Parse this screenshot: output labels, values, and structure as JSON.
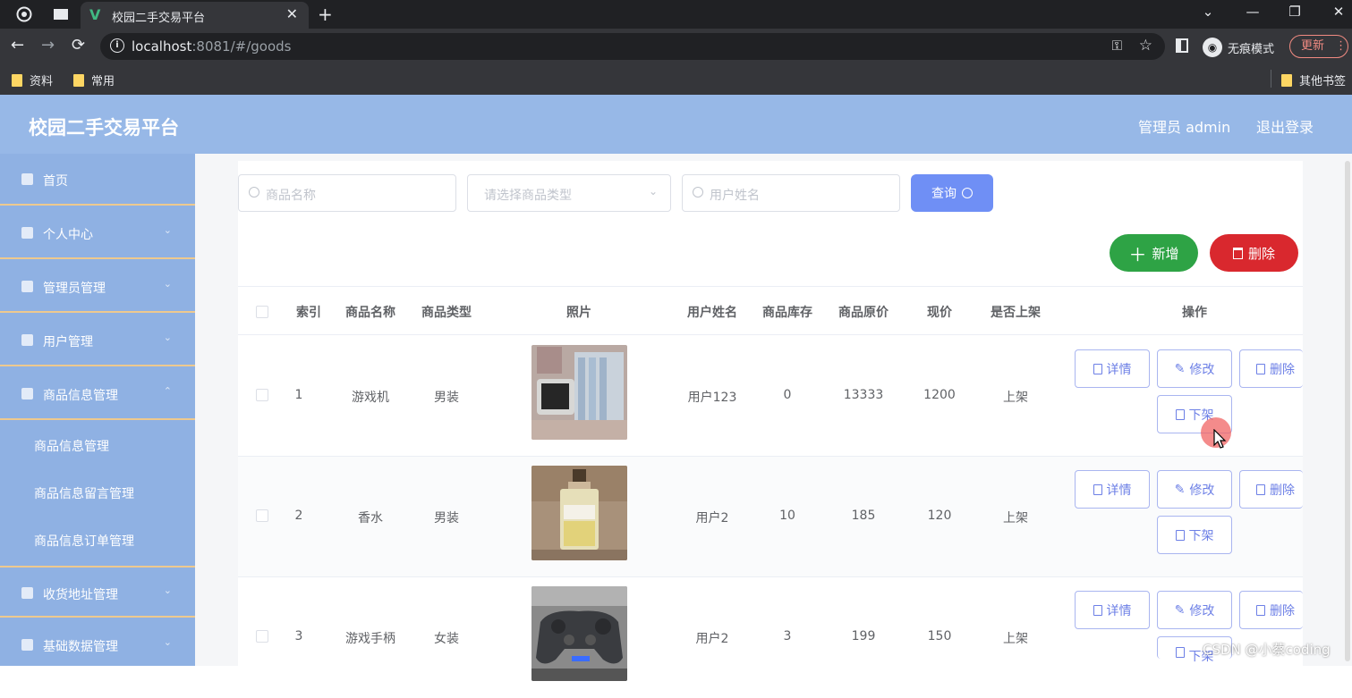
{
  "browser": {
    "tab_title": "校园二手交易平台",
    "url_host": "localhost",
    "url_rest": ":8081/#/goods",
    "incognito_label": "无痕模式",
    "update_label": "更新",
    "bookmarks": [
      "资料",
      "常用"
    ],
    "other_bookmarks": "其他书签"
  },
  "header": {
    "title": "校园二手交易平台",
    "admin": "管理员 admin",
    "logout": "退出登录"
  },
  "sidebar": {
    "items": [
      {
        "label": "首页"
      },
      {
        "label": "个人中心"
      },
      {
        "label": "管理员管理"
      },
      {
        "label": "用户管理"
      },
      {
        "label": "商品信息管理"
      },
      {
        "label": "收货地址管理"
      },
      {
        "label": "基础数据管理"
      }
    ],
    "sub_items": [
      {
        "label": "商品信息管理"
      },
      {
        "label": "商品信息留言管理"
      },
      {
        "label": "商品信息订单管理"
      }
    ]
  },
  "search": {
    "name_placeholder": "商品名称",
    "type_placeholder": "请选择商品类型",
    "user_placeholder": "用户姓名",
    "query_label": "查询"
  },
  "actions": {
    "add_label": "新增",
    "delete_label": "删除"
  },
  "table": {
    "headers": [
      "索引",
      "商品名称",
      "商品类型",
      "照片",
      "用户姓名",
      "商品库存",
      "商品原价",
      "现价",
      "是否上架",
      "操作"
    ],
    "rows": [
      {
        "index": "1",
        "name": "游戏机",
        "type": "男装",
        "user": "用户123",
        "stock": "0",
        "original_price": "13333",
        "price": "1200",
        "status": "上架"
      },
      {
        "index": "2",
        "name": "香水",
        "type": "男装",
        "user": "用户2",
        "stock": "10",
        "original_price": "185",
        "price": "120",
        "status": "上架"
      },
      {
        "index": "3",
        "name": "游戏手柄",
        "type": "女装",
        "user": "用户2",
        "stock": "3",
        "original_price": "199",
        "price": "150",
        "status": "上架"
      }
    ],
    "op_labels": {
      "detail": "详情",
      "edit": "修改",
      "delete": "删除",
      "offshelf": "下架"
    }
  },
  "watermark": "CSDN @小蔡coding",
  "colors": {
    "header_bg": "#97b8e7",
    "sidebar_bg": "#8fb1e3",
    "query_btn": "#6f8ff5",
    "add_btn": "#2ea345",
    "delete_btn": "#d9282e"
  }
}
